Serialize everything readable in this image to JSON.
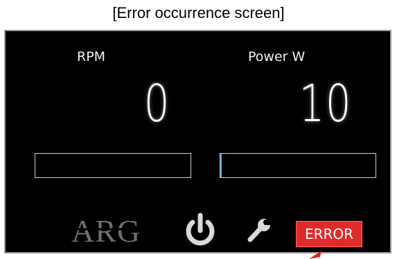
{
  "caption": "[Error occurrence screen]",
  "rpm": {
    "label": "RPM",
    "value": "0",
    "bar_level": 0
  },
  "power": {
    "label": "Power W",
    "value": "10",
    "bar_level": 0.01
  },
  "footer": {
    "logo_text": "ARG",
    "error_label": "ERROR"
  },
  "colors": {
    "screen_background": "#000000",
    "error_red": "#e02b2b",
    "bar_outline": "#c9d3df",
    "bar_fill": "#4aa3df",
    "icon_gray": "#d9d9d9",
    "logo_gray": "#6e6e6e",
    "pointer_red": "#e01f1f"
  },
  "icons": [
    "power-icon",
    "wrench-icon",
    "pointer-arrow-icon"
  ]
}
